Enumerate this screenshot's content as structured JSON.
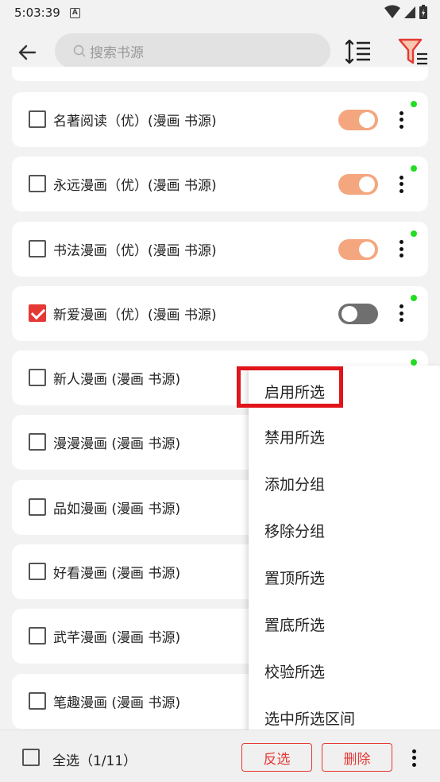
{
  "status": {
    "time": "5:03:39",
    "a_badge": "A"
  },
  "search": {
    "placeholder": "搜索书源"
  },
  "sources": [
    {
      "name": "名著阅读（优）(漫画 书源)",
      "checked": false,
      "enabled": true
    },
    {
      "name": "永远漫画（优）(漫画 书源)",
      "checked": false,
      "enabled": true
    },
    {
      "name": "书法漫画（优）(漫画 书源)",
      "checked": false,
      "enabled": true
    },
    {
      "name": "新爱漫画（优）(漫画 书源)",
      "checked": true,
      "enabled": false
    },
    {
      "name": "新人漫画 (漫画 书源)",
      "checked": false,
      "enabled": true
    },
    {
      "name": "漫漫漫画 (漫画 书源)",
      "checked": false,
      "enabled": true
    },
    {
      "name": "品如漫画 (漫画 书源)",
      "checked": false,
      "enabled": true
    },
    {
      "name": "好看漫画 (漫画 书源)",
      "checked": false,
      "enabled": true
    },
    {
      "name": "武芊漫画 (漫画 书源)",
      "checked": false,
      "enabled": true
    },
    {
      "name": "笔趣漫画 (漫画 书源)",
      "checked": false,
      "enabled": true
    }
  ],
  "menu": {
    "items": [
      "启用所选",
      "禁用所选",
      "添加分组",
      "移除分组",
      "置顶所选",
      "置底所选",
      "校验所选",
      "选中所选区间"
    ]
  },
  "bottom": {
    "select_all": "全选（1/11）",
    "invert": "反选",
    "delete": "删除"
  },
  "colors": {
    "accent": "#e53935",
    "toggle_on": "#f4a67f",
    "toggle_off": "#6f6f6f",
    "online_dot": "#22dd22",
    "highlight": "#e0141a"
  }
}
